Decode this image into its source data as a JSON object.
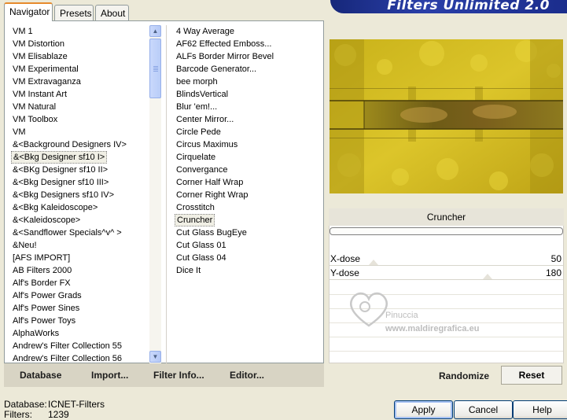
{
  "window": {
    "banner_title": "Filters Unlimited 2.0"
  },
  "tabs": [
    {
      "label": "Navigator",
      "active": true
    },
    {
      "label": "Presets",
      "active": false
    },
    {
      "label": "About",
      "active": false
    }
  ],
  "categories": {
    "items": [
      "VM 1",
      "VM Distortion",
      "VM Elisablaze",
      "VM Experimental",
      "VM Extravaganza",
      "VM Instant Art",
      "VM Natural",
      "VM Toolbox",
      "VM",
      "&<Background Designers IV>",
      "&<Bkg Designer sf10 I>",
      "&<BKg Designer sf10 II>",
      "&<Bkg Designer sf10 III>",
      "&<Bkg Designers sf10 IV>",
      "&<Bkg Kaleidoscope>",
      "&<Kaleidoscope>",
      "&<Sandflower Specials^v^ >",
      "&Neu!",
      "[AFS IMPORT]",
      "AB Filters 2000",
      "Alf's Border FX",
      "Alf's Power Grads",
      "Alf's Power Sines",
      "Alf's Power Toys",
      "AlphaWorks",
      "Andrew's Filter Collection 55",
      "Andrew's Filter Collection 56"
    ],
    "selected_index": 10
  },
  "filters": {
    "items": [
      "4 Way Average",
      "AF62 Effected Emboss...",
      "ALFs Border Mirror Bevel",
      "Barcode Generator...",
      "bee morph",
      "BlindsVertical",
      "Blur 'em!...",
      "Center Mirror...",
      "Circle Pede",
      "Circus Maximus",
      "Cirquelate",
      "Convergance",
      "Corner Half Wrap",
      "Corner Right Wrap",
      "Crosstitch",
      "Cruncher",
      "Cut Glass  BugEye",
      "Cut Glass 01",
      "Cut Glass 04",
      "Dice It"
    ],
    "selected_index": 15
  },
  "toolbar": {
    "database": "Database",
    "import": "Import...",
    "filter_info": "Filter Info...",
    "editor": "Editor..."
  },
  "panel": {
    "filter_name": "Cruncher",
    "params": [
      {
        "label": "X-dose",
        "value": "50",
        "level": 50
      },
      {
        "label": "Y-dose",
        "value": "180",
        "level": 180
      }
    ],
    "watermark_line1": "Pinuccia",
    "watermark_line2": "www.maldiregrafica.eu",
    "randomize": "Randomize",
    "reset": "Reset"
  },
  "status": {
    "database_label": "Database:",
    "database_value": "ICNET-Filters",
    "filters_label": "Filters:",
    "filters_value": "1239"
  },
  "buttons": {
    "apply": "Apply",
    "cancel": "Cancel",
    "help": "Help"
  },
  "colors": {
    "preview_yellow": "#d7c01a",
    "preview_band": "#7a6a14",
    "banner_blue": "#1b2d8c"
  }
}
